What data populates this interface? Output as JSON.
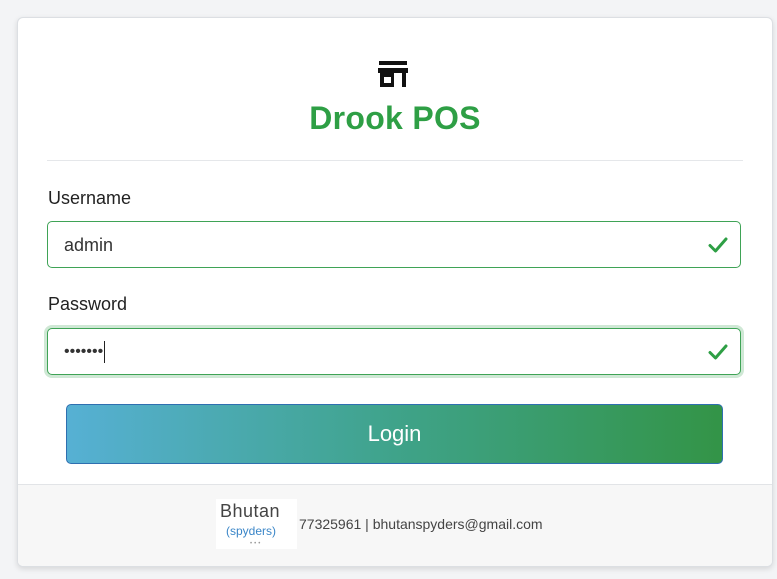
{
  "app": {
    "title": "Drook POS",
    "icon": "store-icon",
    "brand_color": "#2e9f45"
  },
  "form": {
    "username": {
      "label": "Username",
      "value": "admin",
      "status_icon": "check-icon"
    },
    "password": {
      "label": "Password",
      "masked_value": "•••••••",
      "status_icon": "check-icon"
    },
    "submit_label": "Login"
  },
  "footer": {
    "logo": {
      "line1": "Bhutan",
      "line2": "(spyders)"
    },
    "contact": "77325961 | bhutanspyders@gmail.com"
  }
}
